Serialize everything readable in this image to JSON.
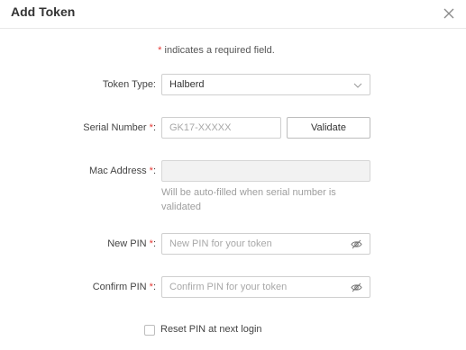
{
  "dialog": {
    "title": "Add Token",
    "close_icon": "close-icon"
  },
  "required_note": {
    "star": "*",
    "text": " indicates a required field."
  },
  "form": {
    "token_type": {
      "label": "Token Type:",
      "value": "Halberd",
      "icon": "chevron-down-icon"
    },
    "serial_number": {
      "label": "Serial Number",
      "star": "*",
      "colon": ":",
      "placeholder": "GK17-XXXXX",
      "validate_label": "Validate"
    },
    "mac_address": {
      "label": "Mac Address",
      "star": "*",
      "colon": ":",
      "value": "",
      "helper": "Will be auto-filled when serial number is validated"
    },
    "new_pin": {
      "label": "New PIN",
      "star": "*",
      "colon": ":",
      "placeholder": "New PIN for your token",
      "icon": "eye-slash-icon"
    },
    "confirm_pin": {
      "label": "Confirm PIN",
      "star": "*",
      "colon": ":",
      "placeholder": "Confirm PIN for your token",
      "icon": "eye-slash-icon"
    },
    "reset_pin": {
      "label": "Reset PIN at next login",
      "checked": false
    }
  },
  "colors": {
    "required_star": "#e53935",
    "border": "#cfcfcf",
    "placeholder": "#a8a8a8",
    "disabled_bg": "#f2f2f2"
  }
}
